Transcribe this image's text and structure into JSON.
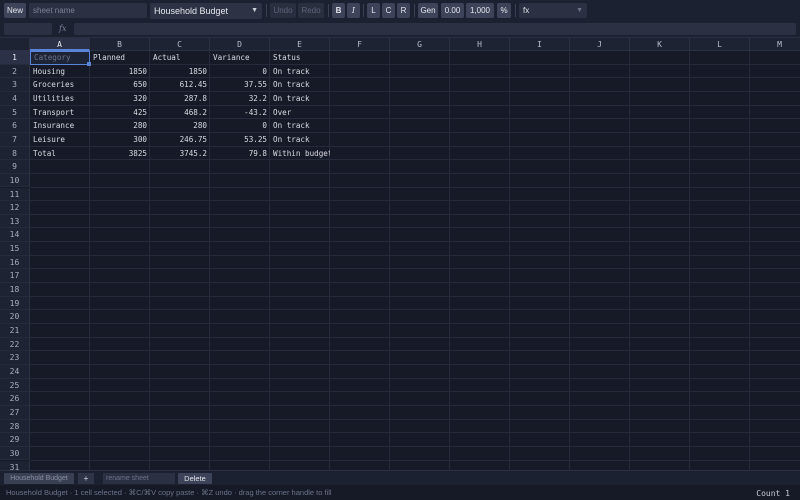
{
  "toolbar": {
    "new_label": "New",
    "sheet_name_placeholder": "sheet name",
    "budget_select": "Household Budget",
    "undo_label": "Undo",
    "redo_label": "Redo",
    "bold_label": "B",
    "italic_label": "I",
    "align_left_label": "L",
    "align_center_label": "C",
    "align_right_label": "R",
    "general_label": "Gen",
    "decimal_label": "0.00",
    "thousands_label": "1,000",
    "percent_label": "%",
    "function_select": "fx"
  },
  "formula_bar": {
    "fx_label": "fx",
    "value": ""
  },
  "grid": {
    "columns": [
      "A",
      "B",
      "C",
      "D",
      "E",
      "F",
      "G",
      "H",
      "I",
      "J",
      "K",
      "L",
      "M"
    ],
    "rows": [
      "1",
      "2",
      "3",
      "4",
      "5",
      "6",
      "7",
      "8",
      "9",
      "10",
      "11",
      "12",
      "13",
      "14",
      "15",
      "16",
      "17",
      "18",
      "19",
      "20",
      "21",
      "22",
      "23",
      "24",
      "25",
      "26",
      "27",
      "28",
      "29",
      "30",
      "31"
    ],
    "cells": [
      [
        "Category",
        "Planned",
        "Actual",
        "Variance",
        "Status"
      ],
      [
        "Housing",
        "1850",
        "1850",
        "0",
        "On track"
      ],
      [
        "Groceries",
        "650",
        "612.45",
        "37.55",
        "On track"
      ],
      [
        "Utilities",
        "320",
        "287.8",
        "32.2",
        "On track"
      ],
      [
        "Transport",
        "425",
        "468.2",
        "-43.2",
        "Over"
      ],
      [
        "Insurance",
        "280",
        "280",
        "0",
        "On track"
      ],
      [
        "Leisure",
        "300",
        "246.75",
        "53.25",
        "On track"
      ],
      [
        "Total",
        "3825",
        "3745.2",
        "79.8",
        "Within budget"
      ]
    ],
    "numeric_columns": [
      1,
      2,
      3
    ]
  },
  "sheet_bar": {
    "tab_label": "Household Budget",
    "add_label": "+",
    "rename_placeholder": "rename sheet",
    "delete_label": "Delete"
  },
  "status": {
    "text": "Household Budget · 1 cell selected · ⌘C/⌘V copy paste · ⌘Z undo · drag the corner handle to fill",
    "count": "Count 1"
  },
  "colors": {
    "background": "#161a26",
    "accent": "#5a84d8"
  }
}
